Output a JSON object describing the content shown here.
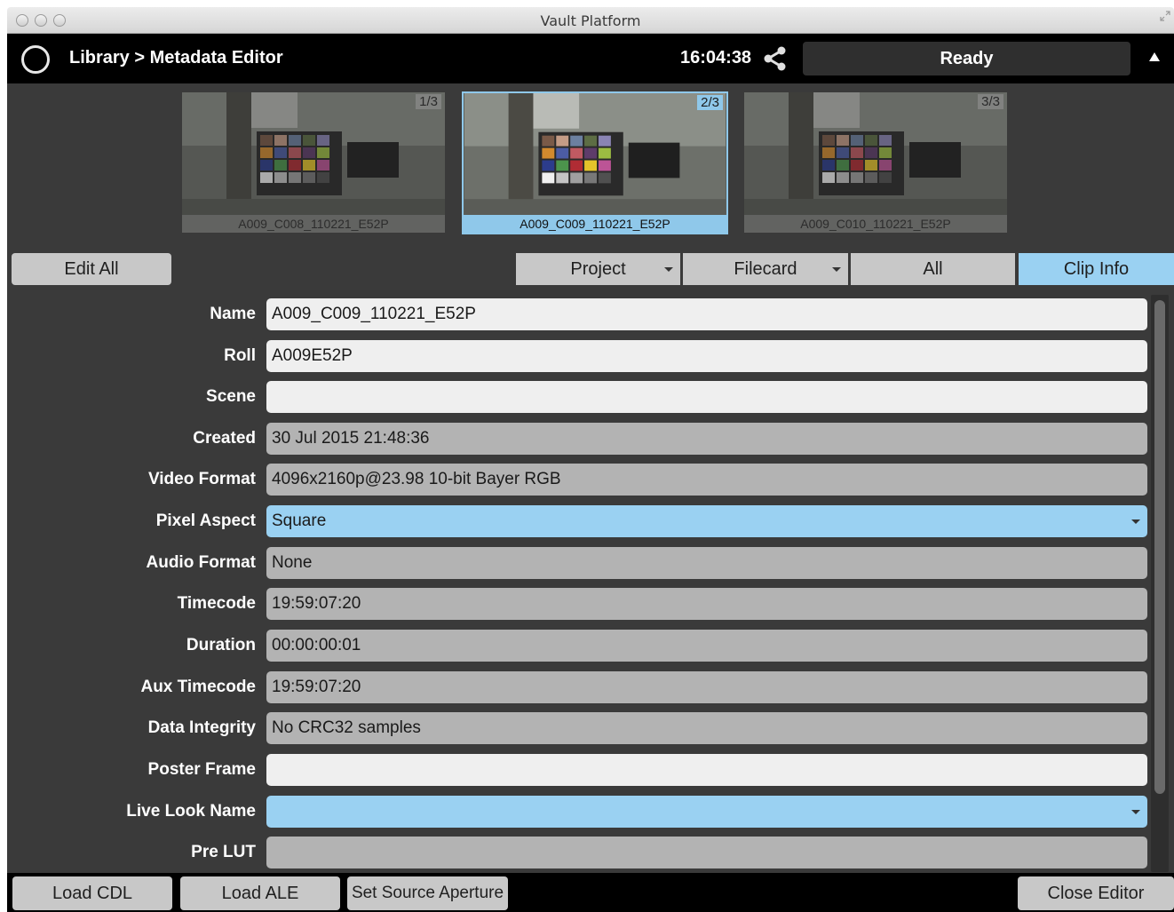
{
  "window": {
    "title": "Vault Platform"
  },
  "header": {
    "breadcrumb": "Library > Metadata Editor",
    "clock": "16:04:38",
    "status": "Ready"
  },
  "thumbnails": [
    {
      "name": "A009_C008_110221_E52P",
      "count": "1/3",
      "selected": false
    },
    {
      "name": "A009_C009_110221_E52P",
      "count": "2/3",
      "selected": true
    },
    {
      "name": "A009_C010_110221_E52P",
      "count": "3/3",
      "selected": false
    }
  ],
  "toolbar": {
    "edit_all": "Edit All",
    "project": "Project",
    "filecard": "Filecard",
    "all": "All",
    "clip_info": "Clip Info"
  },
  "fields": [
    {
      "label": "Name",
      "value": "A009_C009_110221_E52P",
      "kind": "edit"
    },
    {
      "label": "Roll",
      "value": "A009E52P",
      "kind": "edit"
    },
    {
      "label": "Scene",
      "value": "",
      "kind": "edit"
    },
    {
      "label": "Created",
      "value": "30 Jul 2015 21:48:36",
      "kind": "ro"
    },
    {
      "label": "Video Format",
      "value": "4096x2160p@23.98  10-bit Bayer RGB",
      "kind": "ro"
    },
    {
      "label": "Pixel Aspect",
      "value": "Square",
      "kind": "sel"
    },
    {
      "label": "Audio Format",
      "value": "None",
      "kind": "ro"
    },
    {
      "label": "Timecode",
      "value": "19:59:07:20",
      "kind": "ro"
    },
    {
      "label": "Duration",
      "value": "00:00:00:01",
      "kind": "ro"
    },
    {
      "label": "Aux Timecode",
      "value": "19:59:07:20",
      "kind": "ro"
    },
    {
      "label": "Data Integrity",
      "value": "No CRC32 samples",
      "kind": "ro"
    },
    {
      "label": "Poster Frame",
      "value": "",
      "kind": "edit"
    },
    {
      "label": "Live Look Name",
      "value": "",
      "kind": "sel"
    },
    {
      "label": "Pre LUT",
      "value": "",
      "kind": "ro"
    }
  ],
  "bottom": {
    "load_cdl": "Load CDL",
    "load_ale": "Load ALE",
    "set_source_aperture": "Set Source Aperture",
    "close_editor": "Close Editor"
  },
  "colors": {
    "accent": "#9ad1f2",
    "header_bg": "#000000",
    "panel_bg": "#3a3a3a",
    "field_edit": "#efefef",
    "field_readonly": "#b3b3b3"
  }
}
